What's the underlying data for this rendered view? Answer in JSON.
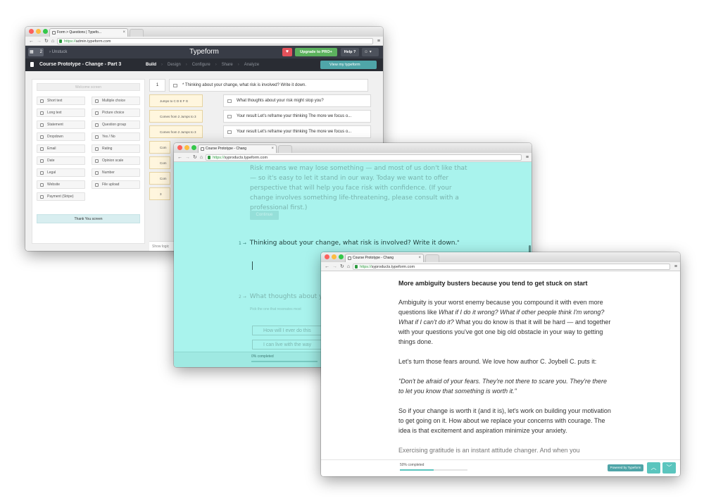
{
  "admin_window": {
    "tab_title": "Form > Questions | Typefo...",
    "url_https": "https://",
    "url_host": "admin.typeform.com",
    "grid_count": "2",
    "unstuck": "Unstuck",
    "brand": "Typeform",
    "upgrade": "Upgrade to PRO+",
    "help": "Help ?",
    "form_title": "Course Prototype - Change - Part 3",
    "steps": [
      "Build",
      "Design",
      "Configure",
      "Share",
      "Analyze"
    ],
    "view_my": "View my typeform",
    "welcome": "Welcome screen",
    "fields": [
      "Short text",
      "Multiple choice",
      "Long text",
      "Picture choice",
      "Statement",
      "Question group",
      "Dropdown",
      "Yes / No",
      "Email",
      "Rating",
      "Date",
      "Opinion scale",
      "Legal",
      "Number",
      "Website",
      "File upload",
      "Payment (Stripe)"
    ],
    "thank_you": "Thank You screen",
    "q1_num": "1",
    "q1_text": "* Thinking about your change, what risk is involved? Write it down.",
    "q2_logic": "Jumps to C D E F G",
    "q2_text": "What thoughts about your risk might stop you?",
    "logic_row": "Comes from 2 Jumps to 3",
    "result_text": "Your result Let's reframe your thinking The more we focus o...",
    "logic_partial": "Com",
    "logic_three": "3",
    "show_logic": "Show logic"
  },
  "teal_window": {
    "tab_title": "Course Prototype - Chang",
    "url_https": "https://",
    "url_host": "syproducts.typeform.com",
    "ghost_text": "Risk means we may lose something — and most of us don't like that — so it's easy to let it stand in our way. Today we want to offer perspective that will help you face risk with confidence. (If your change involves something life-threatening, please consult with a professional first.)",
    "continue": "Continue",
    "q1_num": "1 →",
    "q1_text": "Thinking about your change, what risk is involved? Write it down.",
    "q1_star": "*",
    "q2_num": "2 →",
    "q2_text": "What thoughts about you",
    "hint": "Pick the one that resonates most",
    "choices": [
      "How will I ever do this",
      "I can live with the way"
    ],
    "progress": "0% completed"
  },
  "article_window": {
    "tab_title": "Course Prototype - Chang",
    "url_https": "https://",
    "url_host": "syproducts.typeform.com",
    "heading": "More ambiguity busters because you tend to get stuck on start",
    "p1_a": "Ambiguity is your worst enemy because you compound it with even more questions like ",
    "p1_i": "What if I do it wrong? What if other people think I'm wrong? What if I can't do it?",
    "p1_b": " What you do know is that it will be hard — and together with your questions you've got one big old obstacle in your way to getting things done.",
    "p2": "Let's turn those fears around. We love how author C. Joybell C. puts it:",
    "quote": "\"Don't be afraid of your fears. They're not there to scare you. They're there to let you know that something is worth it.\"",
    "p3": "So if your change is worth it (and it is), let's work on building your motivation to get going on it. How about we replace your concerns with courage. The idea is that excitement and aspiration minimize your anxiety.",
    "p4": "Exercising gratitude is an instant attitude changer. And when you",
    "progress": "50% completed",
    "progress_value": 0.5,
    "powered": "Powered by Typeform"
  },
  "colors": {
    "teal": "#a9f3ed",
    "accent": "#5bc5be",
    "green": "#5cb25e",
    "dark": "#383c46"
  }
}
